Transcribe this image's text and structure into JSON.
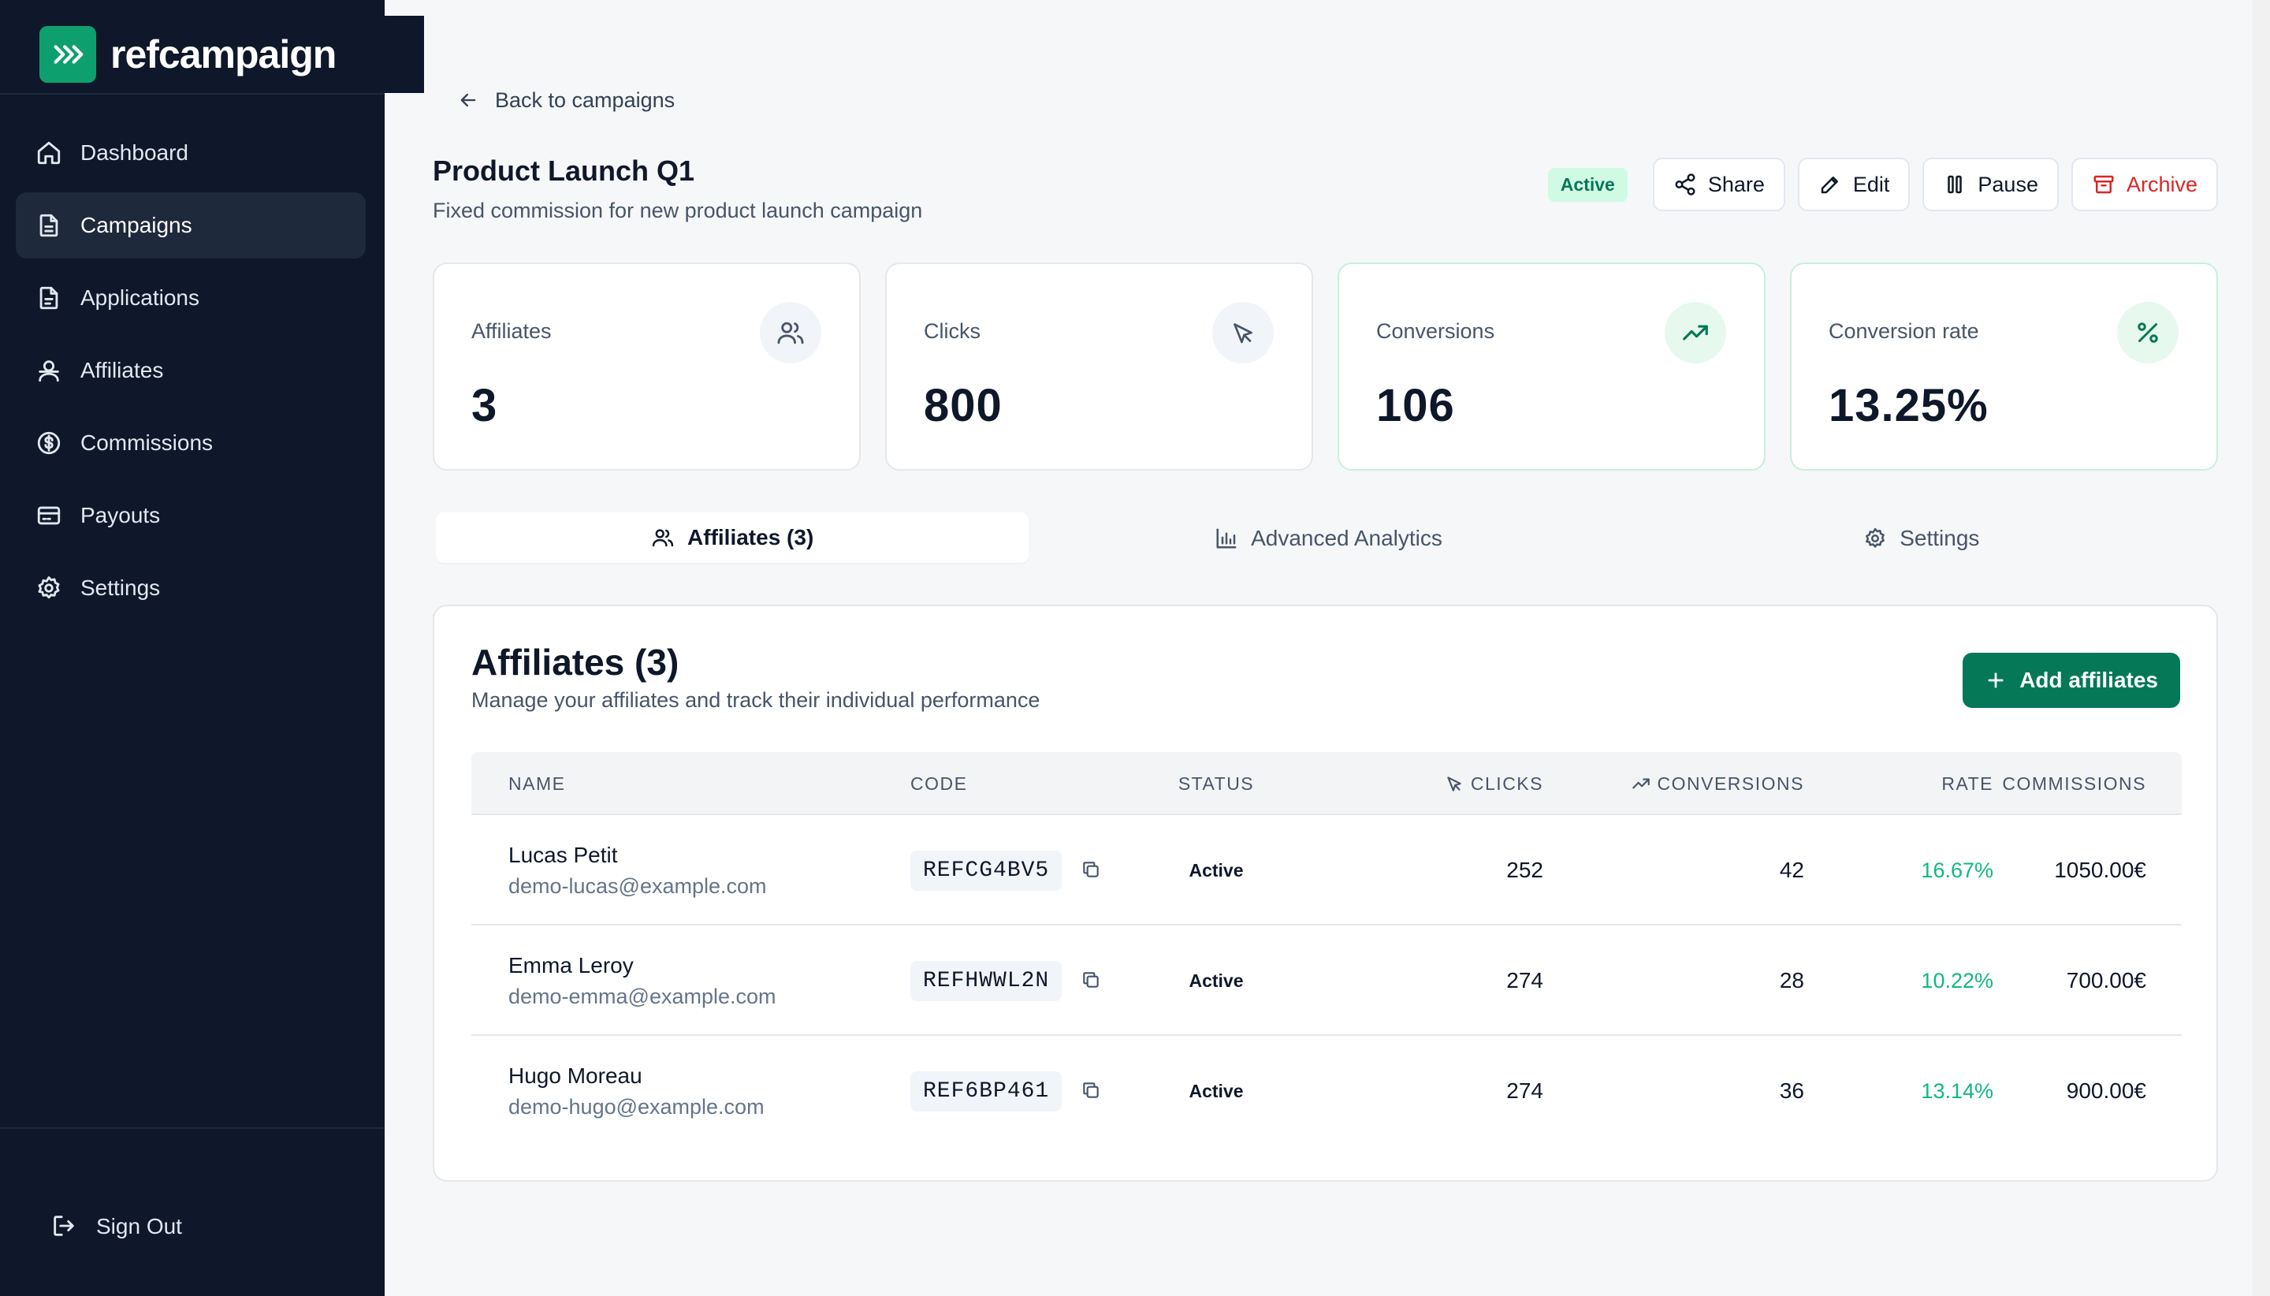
{
  "brand": {
    "name": "refcampaign"
  },
  "sidebar": {
    "items": [
      {
        "label": "Dashboard",
        "icon": "home-icon"
      },
      {
        "label": "Campaigns",
        "icon": "document-icon",
        "active": true
      },
      {
        "label": "Applications",
        "icon": "file-icon"
      },
      {
        "label": "Affiliates",
        "icon": "users-icon"
      },
      {
        "label": "Commissions",
        "icon": "dollar-icon"
      },
      {
        "label": "Payouts",
        "icon": "credit-card-icon"
      },
      {
        "label": "Settings",
        "icon": "gear-icon"
      }
    ],
    "sign_out": "Sign Out"
  },
  "header": {
    "back_label": "Back to campaigns",
    "title": "Product Launch Q1",
    "subtitle": "Fixed commission for new product launch campaign",
    "status": "Active",
    "actions": {
      "share": "Share",
      "edit": "Edit",
      "pause": "Pause",
      "archive": "Archive"
    }
  },
  "stats": [
    {
      "label": "Affiliates",
      "value": "3",
      "icon": "users-icon"
    },
    {
      "label": "Clicks",
      "value": "800",
      "icon": "cursor-icon"
    },
    {
      "label": "Conversions",
      "value": "106",
      "icon": "trending-up-icon"
    },
    {
      "label": "Conversion rate",
      "value": "13.25%",
      "icon": "percent-icon"
    }
  ],
  "tabs": [
    {
      "label": "Affiliates (3)",
      "active": true
    },
    {
      "label": "Advanced Analytics"
    },
    {
      "label": "Settings"
    }
  ],
  "panel": {
    "title": "Affiliates (3)",
    "subtitle": "Manage your affiliates and track their individual performance",
    "add_button": "Add affiliates"
  },
  "table": {
    "columns": [
      "NAME",
      "CODE",
      "STATUS",
      "CLICKS",
      "CONVERSIONS",
      "RATE",
      "COMMISSIONS"
    ],
    "rows": [
      {
        "name": "Lucas Petit",
        "email": "demo-lucas@example.com",
        "code": "REFCG4BV5",
        "status": "Active",
        "clicks": "252",
        "conversions": "42",
        "rate": "16.67%",
        "commissions": "1050.00€"
      },
      {
        "name": "Emma Leroy",
        "email": "demo-emma@example.com",
        "code": "REFHWWL2N",
        "status": "Active",
        "clicks": "274",
        "conversions": "28",
        "rate": "10.22%",
        "commissions": "700.00€"
      },
      {
        "name": "Hugo Moreau",
        "email": "demo-hugo@example.com",
        "code": "REF6BP461",
        "status": "Active",
        "clicks": "274",
        "conversions": "36",
        "rate": "13.14%",
        "commissions": "900.00€"
      }
    ]
  },
  "colors": {
    "sidebar_bg": "#0f172a",
    "brand_green": "#0e9f6e",
    "accent_green": "#047857",
    "rate_green": "#10b981",
    "danger": "#dc2626"
  }
}
